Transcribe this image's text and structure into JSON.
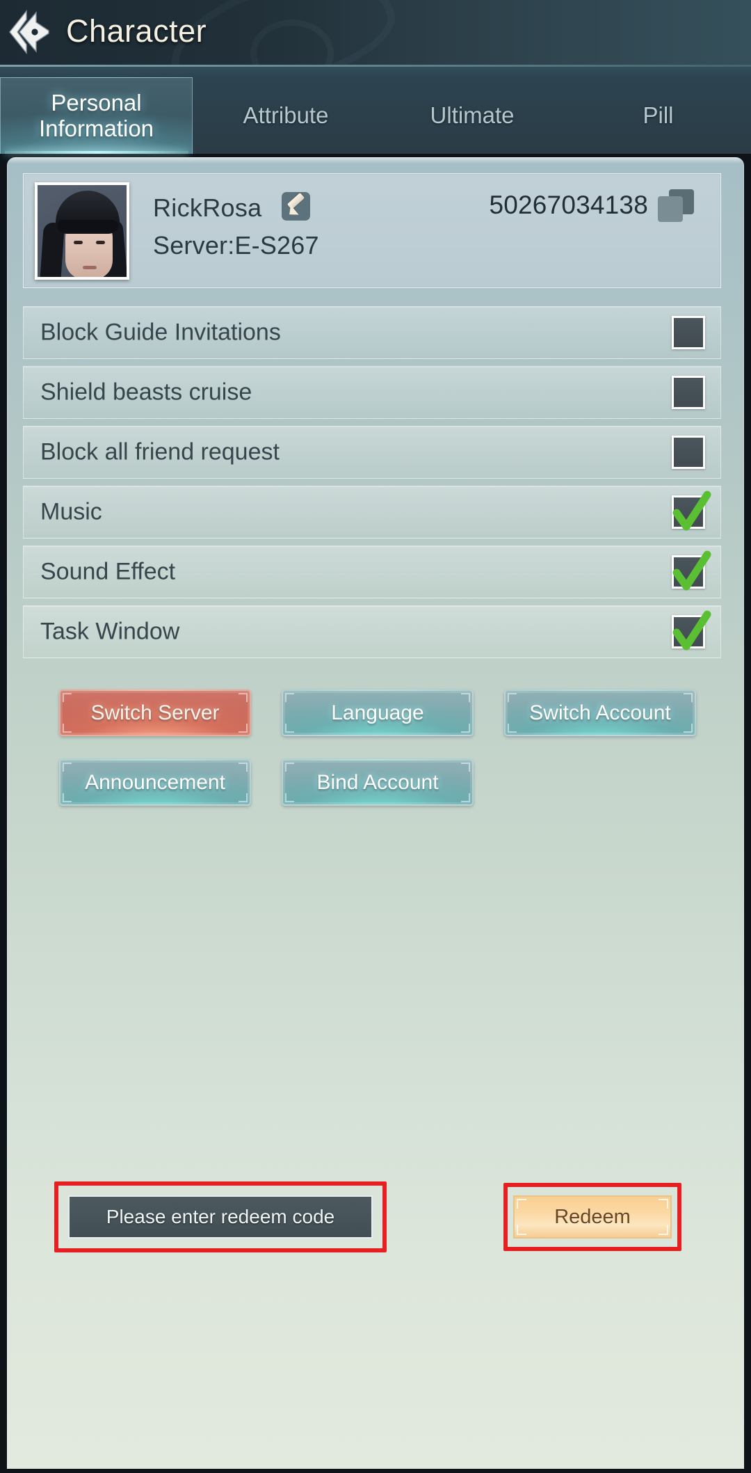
{
  "header": {
    "title": "Character",
    "back_icon": "back-arrow-icon"
  },
  "tabs": [
    {
      "label": "Personal Information",
      "active": true
    },
    {
      "label": "Attribute",
      "active": false
    },
    {
      "label": "Ultimate",
      "active": false
    },
    {
      "label": "Pill",
      "active": false
    }
  ],
  "profile": {
    "name": "RickRosa",
    "server": "Server:E-S267",
    "player_id": "50267034138",
    "edit_icon": "pencil-edit-icon",
    "copy_icon": "copy-icon",
    "avatar_alt": "character-portrait"
  },
  "settings": [
    {
      "label": "Block Guide Invitations",
      "checked": false
    },
    {
      "label": "Shield beasts cruise",
      "checked": false
    },
    {
      "label": "Block all friend request",
      "checked": false
    },
    {
      "label": "Music",
      "checked": true
    },
    {
      "label": "Sound Effect",
      "checked": true
    },
    {
      "label": "Task Window",
      "checked": true
    }
  ],
  "buttons": [
    {
      "label": "Switch Server",
      "style": "red"
    },
    {
      "label": "Language",
      "style": "teal"
    },
    {
      "label": "Switch Account",
      "style": "teal"
    },
    {
      "label": "Announcement",
      "style": "teal"
    },
    {
      "label": "Bind Account",
      "style": "teal"
    }
  ],
  "redeem": {
    "input_placeholder": "Please enter redeem code",
    "input_value": "",
    "button_label": "Redeem",
    "highlight_color": "#e51f22"
  },
  "colors": {
    "accent_teal": "#76a3a6",
    "accent_red": "#c86a5e",
    "accent_gold": "#fbd9a4",
    "check_green": "#5bbf33",
    "panel_top": "#a6bfc6",
    "panel_bottom": "#e2e9de",
    "titlebar": "#213039"
  }
}
